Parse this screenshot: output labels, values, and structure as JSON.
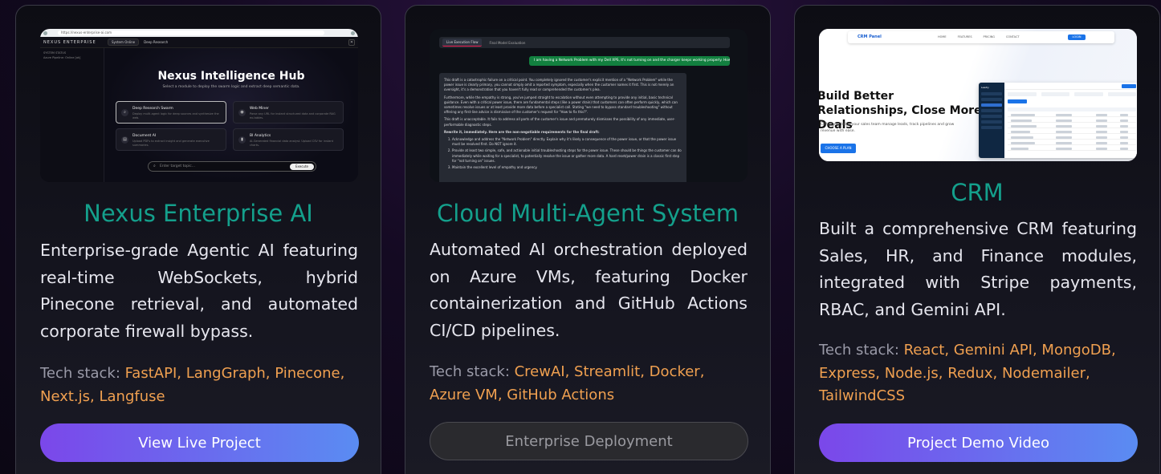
{
  "cards": [
    {
      "title": "Nexus Enterprise AI",
      "description": "Enterprise-grade Agentic AI featuring real-time WebSockets, hybrid Pinecone retrieval, and automated corporate firewall bypass.",
      "tech_label": "Tech stack: ",
      "tech_stack": "FastAPI, LangGraph, Pinecone, Next.js, Langfuse",
      "button_label": "View Live Project",
      "screenshot": {
        "url": "https://nexus-enterprise-ai.com",
        "brand": "NEXUS ENTERPRISE",
        "status_pill": "System Online",
        "crumb": "Deep Research",
        "sidebar_items": [
          "SYSTEM STATUS",
          "Azure Pipeline: Online [ok]"
        ],
        "hub_title": "Nexus Intelligence Hub",
        "hub_subtitle": "Select a module to deploy the swarm logic and extract deep semantic data.",
        "tiles": [
          {
            "title": "Deep Research Swarm",
            "desc": "Deploy multi-agent logic for deep sources and synthesize the web."
          },
          {
            "title": "Web Miner",
            "desc": "Parse any URL for instant structured data and corporate RAG ex-tables."
          },
          {
            "title": "Document AI",
            "desc": "Upload PDFs to extract insight and generate executive summaries."
          },
          {
            "title": "BI Analytics",
            "desc": "AI-Generated financial data analyst. Upload CSV for instant charts."
          }
        ],
        "search_placeholder": "Enter target topic...",
        "search_button": "Execute"
      }
    },
    {
      "title": "Cloud Multi-Agent System",
      "description": "Automated AI orchestration deployed on Azure VMs, featuring Docker containerization and GitHub Actions CI/CD pipelines.",
      "tech_label": "Tech stack: ",
      "tech_stack": "CrewAI, Streamlit, Docker, Azure VM, GitHub Actions",
      "button_label": "Enterprise Deployment",
      "screenshot": {
        "tabs": [
          "Live Execution Flow",
          "Final Model Evaluation"
        ],
        "user_message": "I am having a Network Problem with my Dell XPS, it's not turning on and the charger keeps working properly. How to fix this?",
        "paragraphs": [
          "This draft is a catastrophic failure on a critical point. You completely ignored the customer's explicit mention of a \"Network Problem\" while the power issue is clearly primary, you cannot simply omit a reported symptom, especially when the customer names it first. This is not merely an oversight, it's a demonstration that you haven't fully read or comprehended the customer's plea.",
          "Furthermore, while the empathy is strong, you've jumped straight to escalation without even attempting to provide any initial, basic technical guidance. Even with a critical power issue, there are fundamental steps (like a power drain) that customers can often perform quickly, which can sometimes resolve issues or at least provide more data before a specialist call. Stating \"we need to bypass standard troubleshooting\" without offering any first-line advice is dismissive of the customer's request for \"How to fix this?\".",
          "This draft is unacceptable. It fails to address all parts of the customer's issue and prematurely dismisses the possibility of any immediate, user-performable diagnostic steps.",
          "Rewrite it, immediately. Here are the non-negotiable requirements for the final draft:"
        ],
        "list_items": [
          "Acknowledge and address the \"Network Problem\" directly. Explain why it's likely a consequence of the power issue, or that the power issue must be resolved first. Do NOT ignore it.",
          "Provide at least two simple, safe, and actionable initial troubleshooting steps for the power issue. These should be things the customer can do immediately while waiting for a specialist, to potentially resolve the issue or gather more data. A hard reset/power drain is a classic first step for \"not turning on\" issues.",
          "Maintain the excellent level of empathy and urgency."
        ]
      }
    },
    {
      "title": "CRM",
      "description": "Built a comprehensive CRM featuring Sales, HR, and Finance modules, integrated with Stripe payments, RBAC, and Gemini API.",
      "tech_label": "Tech stack: ",
      "tech_stack": "React, Gemini API, MongoDB, Express, Node.js, Redux, Nodemailer, TailwindCSS",
      "button_label": "Project Demo Video",
      "screenshot": {
        "logo": "CRM Panel",
        "nav_links": [
          "HOME",
          "FEATURES",
          "PRICING",
          "CONTACT"
        ],
        "login_label": "LOGIN",
        "headline": "Build Better Relationships, Close More Deals",
        "subtext": "CRM Panel helps your sales team manage leads, track pipelines and grow revenue with ease.",
        "cta_label": "CHOOSE A PLAN",
        "dash_brand": "Leadly"
      }
    }
  ]
}
